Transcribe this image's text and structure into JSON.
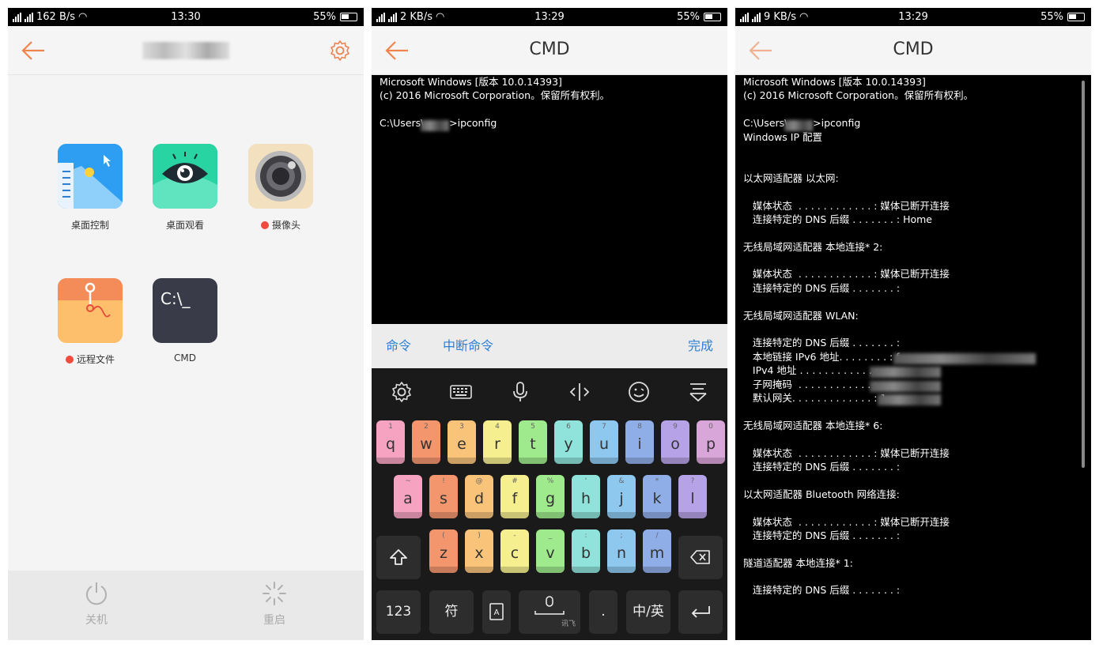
{
  "panels": [
    {
      "status": {
        "speed": "162 B/s",
        "time": "13:30",
        "battery": "55%"
      },
      "apps": [
        {
          "label": "桌面控制"
        },
        {
          "label": "桌面观看"
        },
        {
          "label": "摄像头"
        },
        {
          "label": "远程文件"
        },
        {
          "label": "CMD",
          "icon_text": "C:\\_"
        }
      ],
      "bottom": {
        "shutdown": "关机",
        "restart": "重启"
      }
    },
    {
      "status": {
        "speed": "2 KB/s",
        "time": "13:29",
        "battery": "55%"
      },
      "title": "CMD",
      "terminal": [
        "Microsoft Windows [版本 10.0.14393]",
        "(c) 2016 Microsoft Corporation。保留所有权利。",
        "",
        "C:\\Users\\        >ipconfig"
      ],
      "cmdbar": {
        "command": "命令",
        "interrupt": "中断命令",
        "done": "完成"
      },
      "keyboard": {
        "row1": [
          {
            "c": "q",
            "n": "1"
          },
          {
            "c": "w",
            "n": "2"
          },
          {
            "c": "e",
            "n": "3"
          },
          {
            "c": "r",
            "n": "4"
          },
          {
            "c": "t",
            "n": "5"
          },
          {
            "c": "y",
            "n": "6"
          },
          {
            "c": "u",
            "n": "7"
          },
          {
            "c": "i",
            "n": "8"
          },
          {
            "c": "o",
            "n": "9"
          },
          {
            "c": "p",
            "n": "0"
          }
        ],
        "row2": [
          {
            "c": "a",
            "n": "~"
          },
          {
            "c": "s",
            "n": "!"
          },
          {
            "c": "d",
            "n": "@"
          },
          {
            "c": "f",
            "n": "#"
          },
          {
            "c": "g",
            "n": "%"
          },
          {
            "c": "h",
            "n": "'"
          },
          {
            "c": "j",
            "n": "&"
          },
          {
            "c": "k",
            "n": "*"
          },
          {
            "c": "l",
            "n": "?"
          }
        ],
        "row3": [
          {
            "c": "z",
            "n": "("
          },
          {
            "c": "x",
            "n": ")"
          },
          {
            "c": "c",
            "n": "-"
          },
          {
            "c": "v",
            "n": "_"
          },
          {
            "c": "b",
            "n": ":"
          },
          {
            "c": "n",
            "n": ";"
          },
          {
            "c": "m",
            "n": "/"
          }
        ],
        "num": "123",
        "symbol": "符",
        "space_brand": "讯飞",
        "period": ".",
        "lang": "中/英"
      }
    },
    {
      "status": {
        "speed": "9 KB/s",
        "time": "13:29",
        "battery": "55%"
      },
      "title": "CMD",
      "terminal": [
        "Microsoft Windows [版本 10.0.14393]",
        "(c) 2016 Microsoft Corporation。保留所有权利。",
        "",
        "C:\\Users\\        >ipconfig",
        "Windows IP 配置",
        "",
        "",
        "以太网适配器 以太网:",
        "",
        "   媒体状态  . . . . . . . . . . . . : 媒体已断开连接",
        "   连接特定的 DNS 后缀 . . . . . . . : Home",
        "",
        "无线局域网适配器 本地连接* 2:",
        "",
        "   媒体状态  . . . . . . . . . . . . : 媒体已断开连接",
        "   连接特定的 DNS 后缀 . . . . . . . :",
        "",
        "无线局域网适配器 WLAN:",
        "",
        "   连接特定的 DNS 后缀 . . . . . . . :",
        "   本地链接 IPv6 地址. . . . . . . . : f",
        "   IPv4 地址 . . . . . . . . . . . . :",
        "   子网掩码  . . . . . . . . . . . . :",
        "   默认网关. . . . . . . . . . . . . : 1",
        "",
        "无线局域网适配器 本地连接* 6:",
        "",
        "   媒体状态  . . . . . . . . . . . . : 媒体已断开连接",
        "   连接特定的 DNS 后缀 . . . . . . . :",
        "",
        "以太网适配器 Bluetooth 网络连接:",
        "",
        "   媒体状态  . . . . . . . . . . . . : 媒体已断开连接",
        "   连接特定的 DNS 后缀 . . . . . . . :",
        "",
        "隧道适配器 本地连接* 1:",
        "",
        "   连接特定的 DNS 后缀 . . . . . . . :"
      ]
    }
  ],
  "colors": {
    "accent": "#f0834e",
    "link_blue": "#2e7fd3",
    "key_colors": [
      "#f5a3c0",
      "#f3966e",
      "#f9c37a",
      "#f6ef8f",
      "#9eea8c",
      "#8fe3da",
      "#8ec8ef",
      "#8faee8",
      "#b6a2e6",
      "#d9a6d9"
    ]
  }
}
